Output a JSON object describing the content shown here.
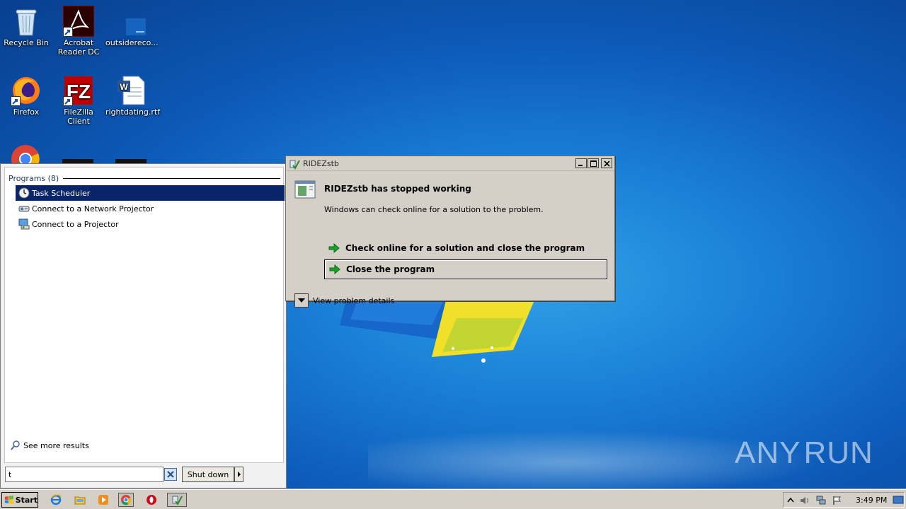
{
  "desktop": {
    "icons": [
      {
        "label": "Recycle Bin"
      },
      {
        "label": "Acrobat Reader DC"
      },
      {
        "label": "outsidereco..."
      },
      {
        "label": "Firefox"
      },
      {
        "label": "FileZilla Client"
      },
      {
        "label": "rightdating.rtf"
      }
    ]
  },
  "start_menu": {
    "programs_header": "Programs (8)",
    "items": [
      {
        "label": "Task Scheduler",
        "icon": "clock-icon",
        "selected": true
      },
      {
        "label": "Connect to a Network Projector",
        "icon": "network-projector-icon",
        "selected": false
      },
      {
        "label": "Connect to a Projector",
        "icon": "projector-icon",
        "selected": false
      }
    ],
    "see_more": "See more results",
    "search_value": "t",
    "shutdown_label": "Shut down"
  },
  "dialog": {
    "title": "RIDEZstb",
    "heading": "RIDEZstb has stopped working",
    "message": "Windows can check online for a solution to the problem.",
    "options": [
      {
        "label": "Check online for a solution and close the program"
      },
      {
        "label": "Close the program"
      }
    ],
    "details_label": "View problem details"
  },
  "taskbar": {
    "start_label": "Start",
    "clock": "3:49 PM"
  },
  "watermark": {
    "left": "ANY",
    "right": "RUN"
  },
  "colors": {
    "selection": "#0a246a",
    "arrow_green": "#1aa32a",
    "desktop_blue": "#1a7fd6"
  }
}
